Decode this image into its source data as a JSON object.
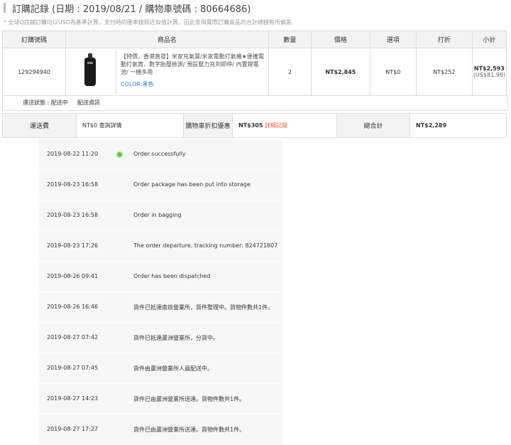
{
  "header": {
    "title": "訂購記錄 (日期 : 2019/08/21 / 購物車號碼 : 80664686)"
  },
  "note": "* 全球Q店鋪訂購均以USD為基準計算，支付時的匯率按照近似值計算，因此會與實際訂購商品的合計總額有所偏差.",
  "order_table": {
    "headers": [
      "訂購號碼",
      "商品名",
      "數量",
      "價格",
      "選項",
      "打折",
      "小計"
    ],
    "row": {
      "order_no": "129294940",
      "product_desc": "【特價，香港直發】米家充氣寶/米家電動打氣機★便攜電動打氣筒，數字胎壓檢測/ 預設壓力充到即停/ 內置鋰電池/ 一機多用",
      "color": "COLOR:黑色",
      "qty": "2",
      "price": "NT$2,845",
      "option": "NT$0",
      "discount": "NT$252",
      "subtotal": "NT$2,593",
      "subtotal_usd": "(US$81.98)"
    }
  },
  "status": {
    "label": "運送狀態 : 配送中",
    "link": "配送資訊"
  },
  "summary": {
    "shipping_label": "運送費",
    "shipping_value": "NT$0 查詢詳情",
    "cart_discount_label": "購物車折扣優惠",
    "cart_discount_value": "NT$305",
    "detail_link": "詳細記錄",
    "total_label": "總合計",
    "total_value": "NT$2,289"
  },
  "timeline": [
    {
      "time": "2019-08-22 11:20",
      "msg": "Order successfully"
    },
    {
      "time": "2019-08-23 16:58",
      "msg": "Order package has been put into storage"
    },
    {
      "time": "2019-08-23 16:58",
      "msg": "Order in bagging"
    },
    {
      "time": "2019-08-23 17:26",
      "msg": "The order departure. tracking number:  824721807"
    },
    {
      "time": "2019-08-26 09:41",
      "msg": "Order has been dispatched"
    },
    {
      "time": "2019-08-26 16:46",
      "msg": "貨件已抵達南崁營業所，貨件整理中。貨物件數共1件。"
    },
    {
      "time": "2019-08-27 07:42",
      "msg": "貨件已抵達蘆洲營業所，分貨中。"
    },
    {
      "time": "2019-08-27 07:45",
      "msg": "貨件由蘆洲營業所人員配送中。"
    },
    {
      "time": "2019-08-27 14:23",
      "msg": "貨件已由蘆洲營業所送達。貨物件數共1件。"
    },
    {
      "time": "2019-08-27 17:27",
      "msg": "貨件已由蘆洲營業所送達。貨物件數共1件。"
    }
  ],
  "colors": {
    "accent_green": "#69c34e",
    "link_blue": "#3a7bd5",
    "link_orange": "#f06030"
  }
}
